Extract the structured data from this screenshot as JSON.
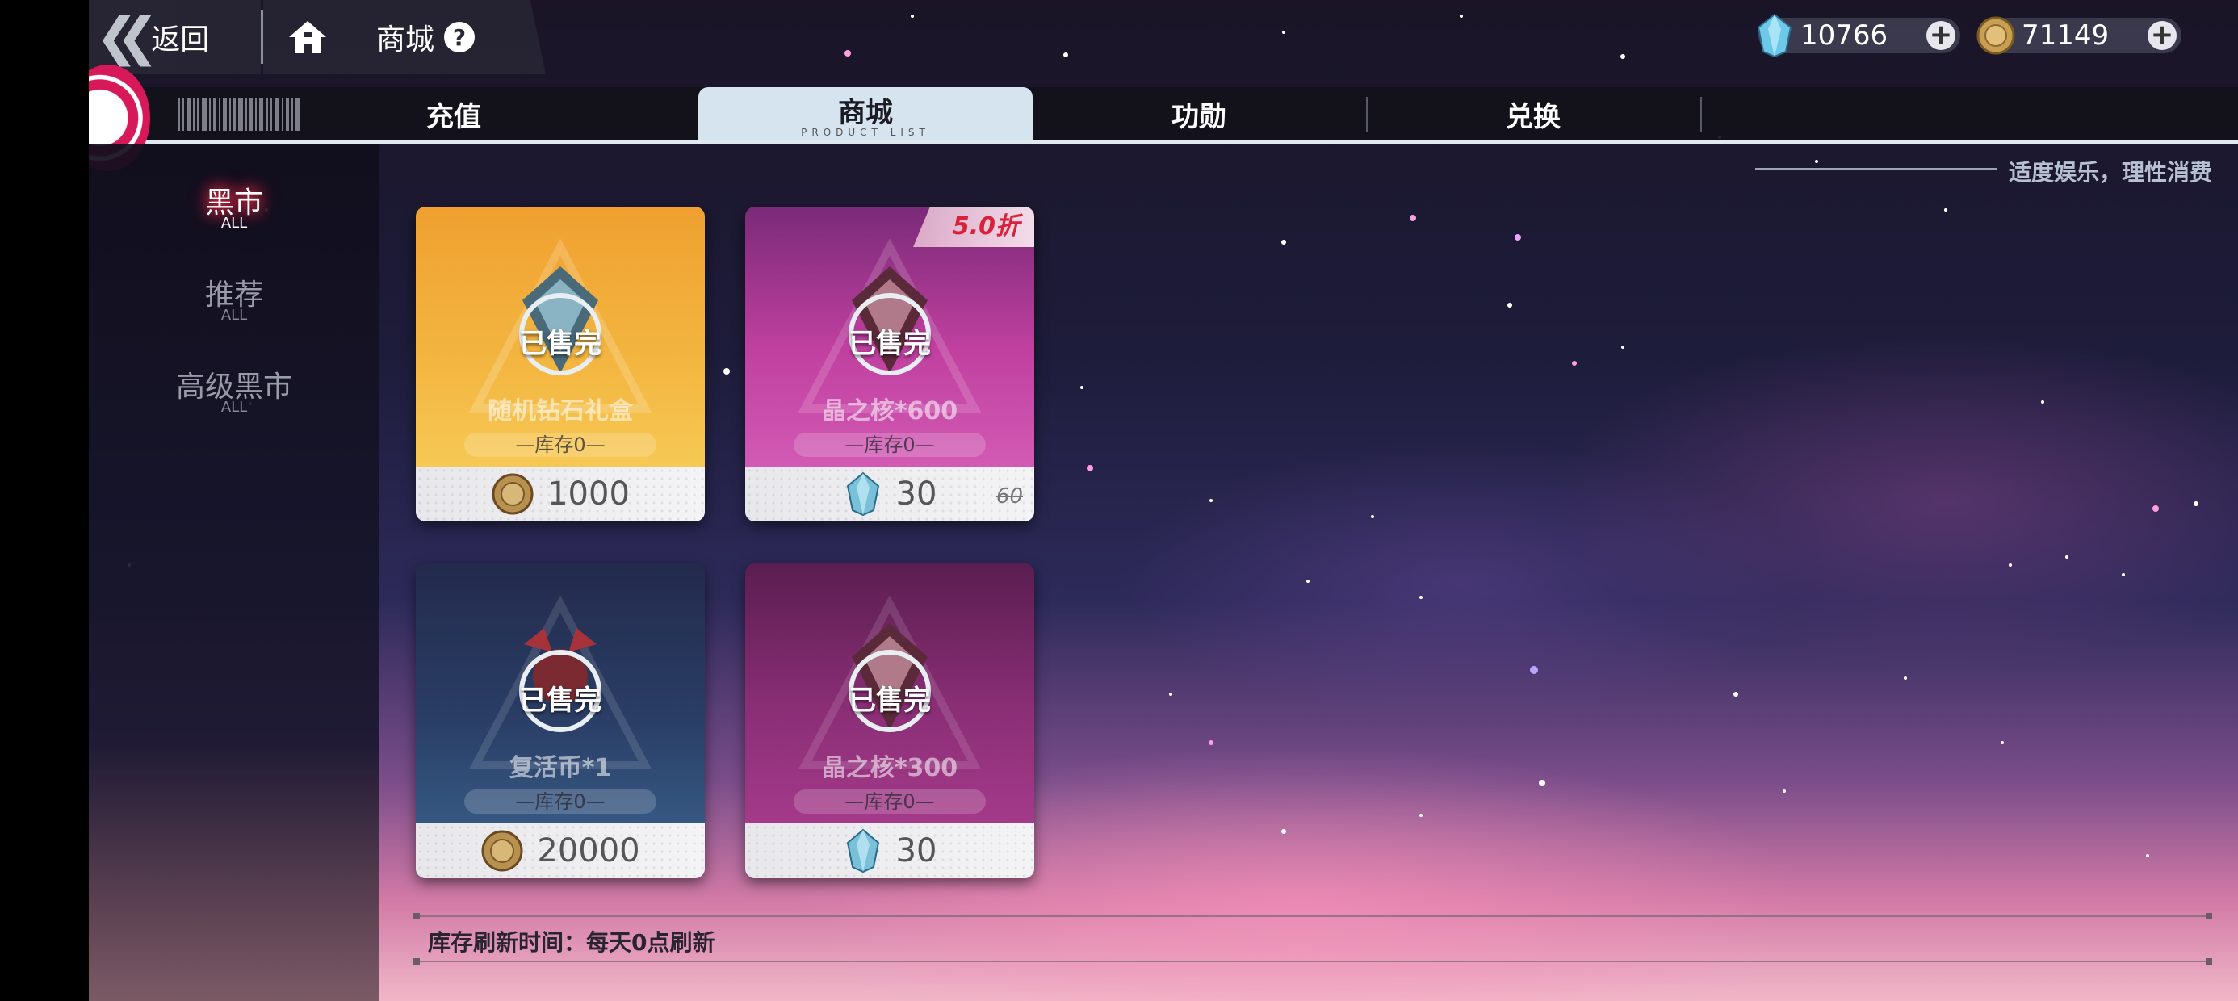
{
  "topbar": {
    "back_label": "返回",
    "shop_label": "商城",
    "help_glyph": "?",
    "crystal_amount": "10766",
    "coin_amount": "71149",
    "plus_glyph": "+"
  },
  "tabs": [
    {
      "label": "充值"
    },
    {
      "label": "商城",
      "sub": "PRODUCT LIST"
    },
    {
      "label": "功勋"
    },
    {
      "label": "兑换"
    }
  ],
  "sidebar": [
    {
      "label": "黑市",
      "sub": "ALL",
      "active": true
    },
    {
      "label": "推荐",
      "sub": "ALL",
      "active": false
    },
    {
      "label": "高级黑市",
      "sub": "ALL",
      "active": false
    }
  ],
  "motto": "适度娱乐，理性消费",
  "products": [
    {
      "name": "随机钻石礼盒",
      "status": "已售完",
      "stock": "—库存0—",
      "price": "1000",
      "currency": "coin"
    },
    {
      "name": "晶之核*600",
      "status": "已售完",
      "stock": "—库存0—",
      "price": "30",
      "original_price": "60",
      "discount": "5.0折",
      "currency": "crystal"
    },
    {
      "name": "复活币*1",
      "status": "已售完",
      "stock": "—库存0—",
      "price": "20000",
      "currency": "coin"
    },
    {
      "name": "晶之核*300",
      "status": "已售完",
      "stock": "—库存0—",
      "price": "30",
      "currency": "crystal"
    }
  ],
  "refresh_note": "库存刷新时间：每天0点刷新",
  "colors": {
    "accent_red": "#d8223c",
    "tab_active": "#d5e4ef"
  },
  "icons": [
    "back-chevron-icon",
    "home-icon",
    "help-icon",
    "crystal-icon",
    "coin-icon",
    "plus-icon",
    "sold-out-emblem-icon"
  ]
}
